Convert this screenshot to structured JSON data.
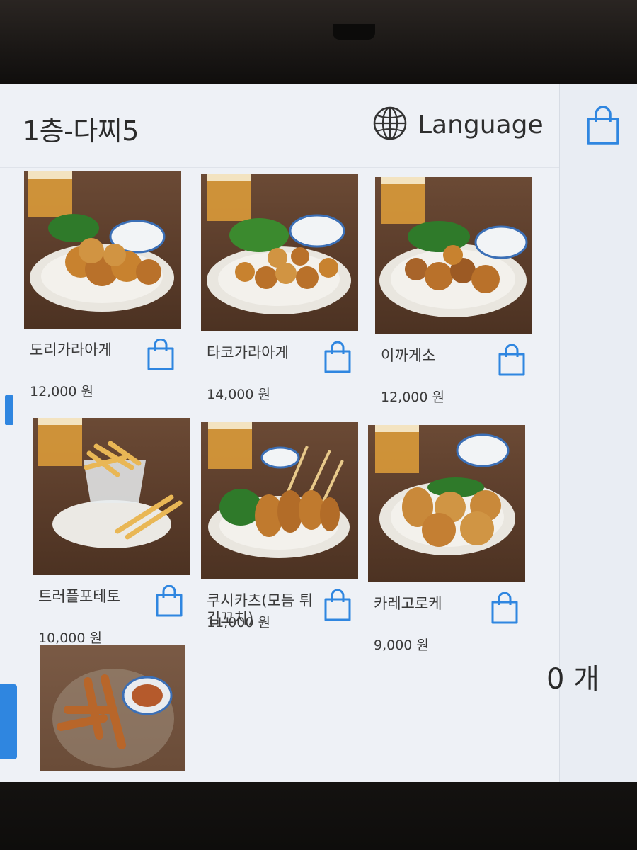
{
  "header": {
    "table_name": "1층-다찌5",
    "language_label": "Language"
  },
  "menu_items": [
    {
      "name": "도리가라아게",
      "price": "12,000 원"
    },
    {
      "name": "타코가라아게",
      "price": "14,000 원"
    },
    {
      "name": "이까게소",
      "price": "12,000 원"
    },
    {
      "name": "트러플포테토",
      "price": "10,000 원"
    },
    {
      "name": "쿠시카츠(모듬 튀김꼬치)",
      "price": "11,000 원"
    },
    {
      "name": "카레고로케",
      "price": "9,000 원"
    }
  ],
  "cart": {
    "count_label": "0 개"
  },
  "colors": {
    "accent": "#2f86e0",
    "screen_bg": "#eef1f6"
  },
  "icons": {
    "language": "globe-icon",
    "cart": "shopping-bag-icon",
    "add_to_cart": "shopping-bag-icon"
  }
}
